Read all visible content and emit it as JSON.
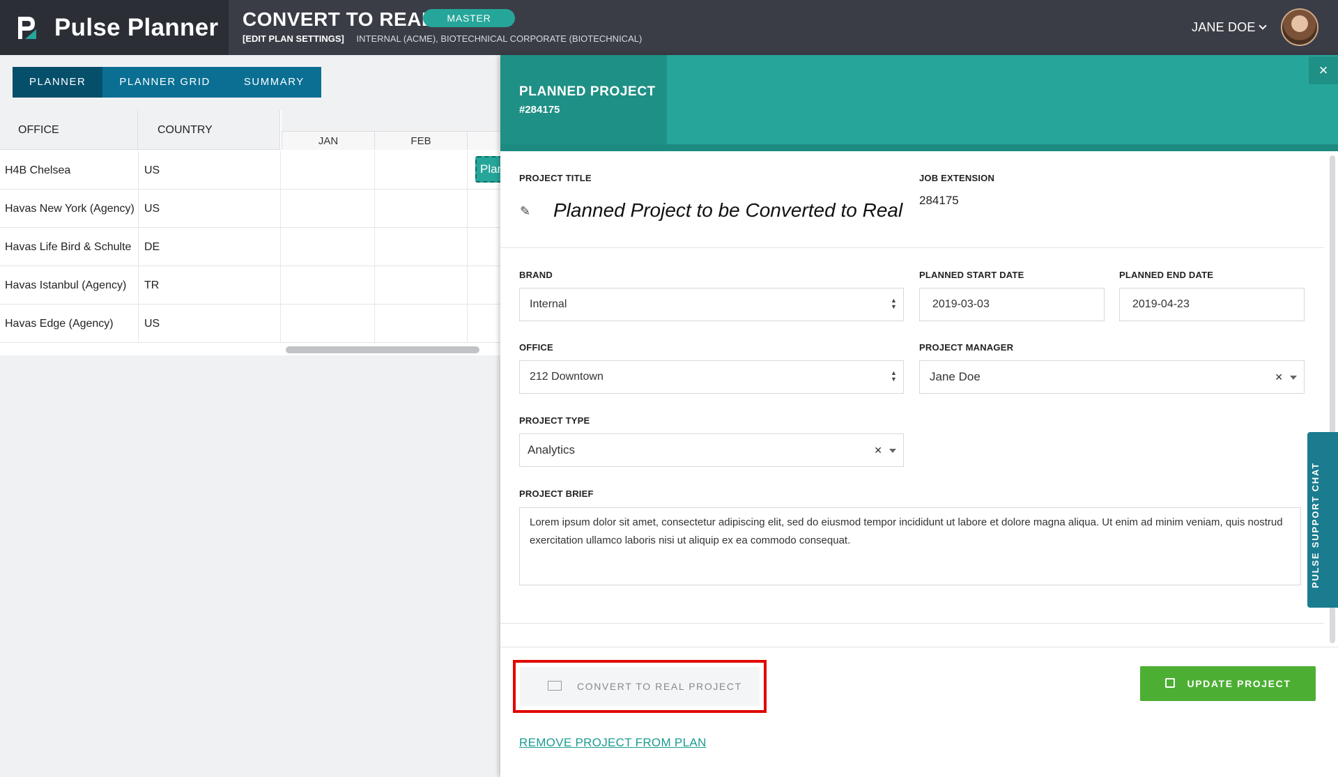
{
  "app": {
    "name": "Pulse Planner"
  },
  "header": {
    "page_title": "CONVERT TO REAL",
    "badge": "MASTER",
    "edit_link": "[EDIT PLAN SETTINGS]",
    "meta": "INTERNAL (ACME), BIOTECHNICAL CORPORATE (BIOTECHNICAL)",
    "user": "JANE DOE"
  },
  "tabs": [
    {
      "label": "PLANNER",
      "active": true
    },
    {
      "label": "PLANNER GRID",
      "active": false
    },
    {
      "label": "SUMMARY",
      "active": false
    }
  ],
  "grid": {
    "columns": {
      "office": "OFFICE",
      "country": "COUNTRY"
    },
    "months": [
      "JAN",
      "FEB"
    ],
    "rows": [
      {
        "office": "H4B Chelsea",
        "country": "US"
      },
      {
        "office": "Havas New York (Agency)",
        "country": "US"
      },
      {
        "office": "Havas Life Bird & Schulte",
        "country": "DE"
      },
      {
        "office": "Havas Istanbul (Agency)",
        "country": "TR"
      },
      {
        "office": "Havas Edge (Agency)",
        "country": "US"
      }
    ],
    "chip_label": "Plan"
  },
  "panel": {
    "heading": "PLANNED PROJECT",
    "number": "#284175",
    "close": "×",
    "project_title_label": "PROJECT TITLE",
    "project_title": "Planned Project to be Converted to Real",
    "job_extension_label": "JOB EXTENSION",
    "job_extension": "284175",
    "brand_label": "BRAND",
    "brand": "Internal",
    "start_label": "PLANNED START DATE",
    "start": "2019-03-03",
    "end_label": "PLANNED END DATE",
    "end": "2019-04-23",
    "office_label": "OFFICE",
    "office": "212 Downtown",
    "pm_label": "PROJECT MANAGER",
    "pm": "Jane Doe",
    "type_label": "PROJECT TYPE",
    "type": "Analytics",
    "brief_label": "PROJECT BRIEF",
    "brief": "Lorem ipsum dolor sit amet, consectetur adipiscing elit, sed do eiusmod tempor incididunt ut labore et dolore magna aliqua. Ut enim ad minim veniam, quis nostrud exercitation ullamco laboris nisi ut aliquip ex ea commodo consequat.",
    "convert_button": "CONVERT TO REAL PROJECT",
    "update_button": "UPDATE PROJECT",
    "remove_link": "REMOVE PROJECT FROM PLAN"
  },
  "support_chat": "PULSE SUPPORT CHAT",
  "colors": {
    "teal": "#26a69a",
    "navy_tab": "#0a6f93",
    "green": "#4caf34",
    "highlight": "#e10600"
  }
}
